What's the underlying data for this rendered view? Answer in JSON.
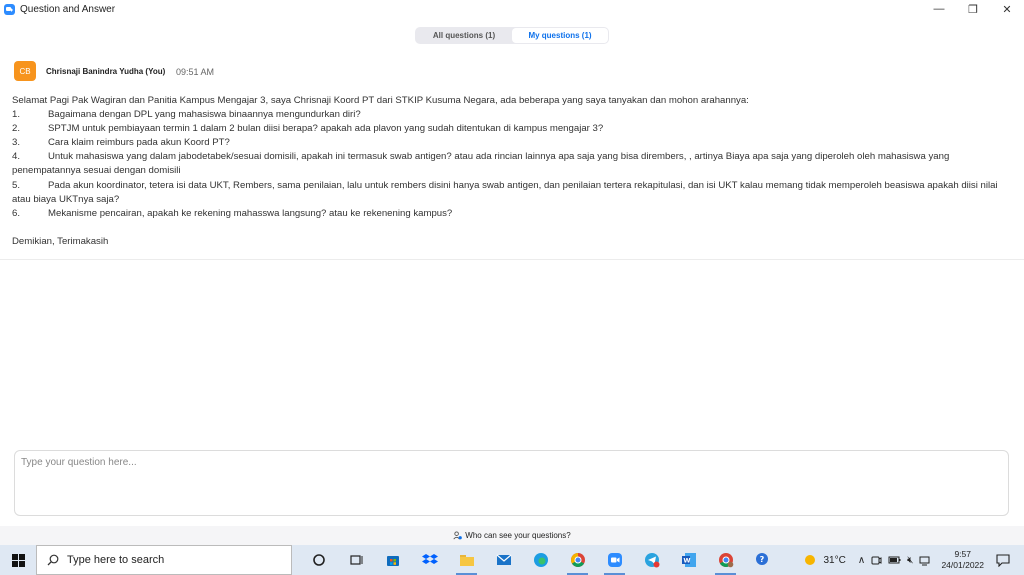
{
  "window": {
    "title": "Question and Answer",
    "minimize": "—",
    "maximize": "❐",
    "close": "✕"
  },
  "tabs": [
    {
      "label": "All questions (1)",
      "active": false
    },
    {
      "label": "My questions (1)",
      "active": true
    }
  ],
  "message": {
    "avatar_initials": "CB",
    "author": "Chrisnaji Banindra Yudha (You)",
    "time": "09:51 AM",
    "intro": "Selamat Pagi Pak Wagiran dan Panitia Kampus Mengajar 3, saya Chrisnaji Koord PT dari STKIP Kusuma Negara, ada beberapa yang saya tanyakan dan mohon arahannya:",
    "items": [
      {
        "num": "1.",
        "text": "Bagaimana dengan DPL  yang mahasiswa binaannya mengundurkan diri?"
      },
      {
        "num": "2.",
        "text": "SPTJM untuk pembiayaan termin 1 dalam 2 bulan diisi berapa? apakah ada plavon yang sudah ditentukan di kampus mengajar 3?"
      },
      {
        "num": "3.",
        "text": "Cara klaim reimburs pada akun Koord PT?"
      },
      {
        "num": "4.",
        "text": "Untuk mahasiswa yang dalam jabodetabek/sesuai domisili, apakah ini termasuk swab antigen? atau ada rincian lainnya apa saja yang bisa dirembers, , artinya Biaya apa saja yang diperoleh oleh mahasiswa yang penempatannya sesuai dengan domisili"
      },
      {
        "num": "5.",
        "text": "Pada akun koordinator, tetera isi data UKT, Rembers, sama penilaian, lalu untuk rembers disini hanya swab antigen, dan penilaian tertera rekapitulasi, dan isi UKT kalau memang tidak memperoleh beasiswa apakah diisi nilai atau biaya UKTnya saja?"
      },
      {
        "num": "6.",
        "text": "Mekanisme pencairan, apakah ke rekening mahasswa langsung? atau ke rekenening kampus?"
      }
    ],
    "closing": "Demikian, Terimakasih"
  },
  "input": {
    "placeholder": "Type your question here..."
  },
  "footer": {
    "who_label": "Who can see your questions?"
  },
  "taskbar": {
    "search_placeholder": "Type here to search",
    "temperature": "31°C",
    "time": "9:57",
    "date": "24/01/2022"
  },
  "colors": {
    "accent": "#0e71eb",
    "avatar": "#f7941d",
    "zoom_blue": "#2d8cff"
  }
}
